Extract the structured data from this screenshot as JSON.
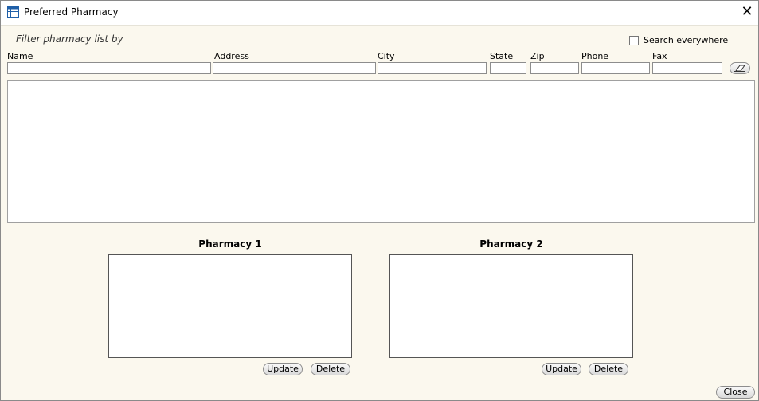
{
  "window": {
    "title": "Preferred Pharmacy",
    "close_glyph": "✕"
  },
  "filter": {
    "caption": "Filter pharmacy list by",
    "search_everywhere_label": "Search everywhere",
    "search_everywhere_checked": false,
    "fields": {
      "name": {
        "label": "Name",
        "value": ""
      },
      "address": {
        "label": "Address",
        "value": ""
      },
      "city": {
        "label": "City",
        "value": ""
      },
      "state": {
        "label": "State",
        "value": ""
      },
      "zip": {
        "label": "Zip",
        "value": ""
      },
      "phone": {
        "label": "Phone",
        "value": ""
      },
      "fax": {
        "label": "Fax",
        "value": ""
      }
    },
    "clear_icon": "eraser-icon"
  },
  "results": {
    "rows": []
  },
  "pharmacy1": {
    "title": "Pharmacy 1",
    "update_label": "Update",
    "delete_label": "Delete"
  },
  "pharmacy2": {
    "title": "Pharmacy 2",
    "update_label": "Update",
    "delete_label": "Delete"
  },
  "footer": {
    "close_label": "Close"
  },
  "colors": {
    "dialog_background": "#fbf8ee",
    "titlebar": "#ffffff",
    "border": "#8a8a8a"
  }
}
